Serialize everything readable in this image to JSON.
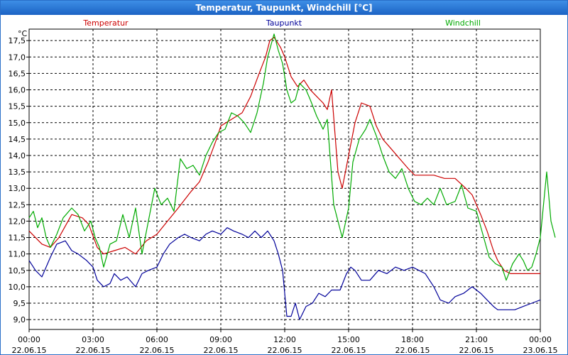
{
  "window": {
    "title": "Temperatur, Taupunkt, Windchill [°C]"
  },
  "chart_data": {
    "type": "line",
    "title": "Temperatur, Taupunkt, Windchill [°C]",
    "ylabel": "°C",
    "xlabel": "",
    "ylim": [
      8.7,
      17.85
    ],
    "xlim": [
      0,
      24
    ],
    "grid": true,
    "legend_position": "top",
    "y_ticks": [
      "9,0",
      "9,5",
      "10,0",
      "10,5",
      "11,0",
      "11,5",
      "12,0",
      "12,5",
      "13,0",
      "13,5",
      "14,0",
      "14,5",
      "15,0",
      "15,5",
      "16,0",
      "16,5",
      "17,0",
      "17,5"
    ],
    "y_tick_values": [
      9.0,
      9.5,
      10.0,
      10.5,
      11.0,
      11.5,
      12.0,
      12.5,
      13.0,
      13.5,
      14.0,
      14.5,
      15.0,
      15.5,
      16.0,
      16.5,
      17.0,
      17.5
    ],
    "x_ticks": [
      {
        "x": 0,
        "time": "00:00",
        "date": "22.06.15"
      },
      {
        "x": 3,
        "time": "03:00",
        "date": "22.06.15"
      },
      {
        "x": 6,
        "time": "06:00",
        "date": "22.06.15"
      },
      {
        "x": 9,
        "time": "09:00",
        "date": "22.06.15"
      },
      {
        "x": 12,
        "time": "12:00",
        "date": "22.06.15"
      },
      {
        "x": 15,
        "time": "15:00",
        "date": "22.06.15"
      },
      {
        "x": 18,
        "time": "18:00",
        "date": "22.06.15"
      },
      {
        "x": 21,
        "time": "21:00",
        "date": "22.06.15"
      },
      {
        "x": 24,
        "time": "00:00",
        "date": "23.06.15"
      }
    ],
    "series": [
      {
        "name": "Temperatur",
        "color": "#cc0000",
        "points": [
          [
            0,
            11.7
          ],
          [
            0.6,
            11.3
          ],
          [
            1.0,
            11.2
          ],
          [
            1.4,
            11.5
          ],
          [
            2.0,
            12.2
          ],
          [
            2.5,
            12.1
          ],
          [
            2.8,
            11.9
          ],
          [
            3.2,
            11.2
          ],
          [
            3.5,
            11.0
          ],
          [
            4.0,
            11.1
          ],
          [
            4.5,
            11.2
          ],
          [
            5.0,
            11.0
          ],
          [
            5.5,
            11.4
          ],
          [
            6.0,
            11.6
          ],
          [
            6.5,
            12.0
          ],
          [
            7.0,
            12.4
          ],
          [
            7.6,
            12.9
          ],
          [
            8.0,
            13.2
          ],
          [
            8.4,
            13.8
          ],
          [
            8.8,
            14.5
          ],
          [
            9.0,
            14.9
          ],
          [
            9.5,
            15.1
          ],
          [
            10.0,
            15.3
          ],
          [
            10.4,
            15.8
          ],
          [
            10.8,
            16.5
          ],
          [
            11.1,
            17.0
          ],
          [
            11.3,
            17.5
          ],
          [
            11.5,
            17.6
          ],
          [
            11.8,
            17.3
          ],
          [
            12.0,
            17.0
          ],
          [
            12.3,
            16.4
          ],
          [
            12.6,
            16.1
          ],
          [
            12.9,
            16.3
          ],
          [
            13.2,
            16.0
          ],
          [
            13.5,
            15.8
          ],
          [
            13.8,
            15.6
          ],
          [
            14.0,
            15.4
          ],
          [
            14.2,
            16.0
          ],
          [
            14.5,
            13.5
          ],
          [
            14.7,
            13.0
          ],
          [
            15.0,
            14.0
          ],
          [
            15.3,
            15.0
          ],
          [
            15.6,
            15.6
          ],
          [
            16.0,
            15.5
          ],
          [
            16.3,
            14.9
          ],
          [
            16.6,
            14.5
          ],
          [
            17.0,
            14.2
          ],
          [
            17.4,
            13.9
          ],
          [
            17.8,
            13.6
          ],
          [
            18.1,
            13.4
          ],
          [
            18.5,
            13.4
          ],
          [
            19.0,
            13.4
          ],
          [
            19.5,
            13.3
          ],
          [
            20.0,
            13.3
          ],
          [
            20.5,
            13.0
          ],
          [
            20.8,
            12.8
          ],
          [
            21.2,
            12.2
          ],
          [
            21.5,
            11.7
          ],
          [
            21.8,
            11.1
          ],
          [
            22.0,
            10.8
          ],
          [
            22.3,
            10.5
          ],
          [
            22.6,
            10.4
          ],
          [
            23.0,
            10.4
          ],
          [
            23.5,
            10.4
          ],
          [
            23.8,
            10.4
          ],
          [
            24.0,
            10.4
          ]
        ]
      },
      {
        "name": "Taupunkt",
        "color": "#000099",
        "points": [
          [
            0,
            10.8
          ],
          [
            0.3,
            10.5
          ],
          [
            0.6,
            10.3
          ],
          [
            1.0,
            10.9
          ],
          [
            1.3,
            11.3
          ],
          [
            1.7,
            11.4
          ],
          [
            2.0,
            11.1
          ],
          [
            2.3,
            11.0
          ],
          [
            2.7,
            10.8
          ],
          [
            3.0,
            10.6
          ],
          [
            3.2,
            10.2
          ],
          [
            3.5,
            10.0
          ],
          [
            3.8,
            10.1
          ],
          [
            4.0,
            10.4
          ],
          [
            4.3,
            10.2
          ],
          [
            4.6,
            10.3
          ],
          [
            5.0,
            10.0
          ],
          [
            5.3,
            10.4
          ],
          [
            5.6,
            10.5
          ],
          [
            6.0,
            10.6
          ],
          [
            6.3,
            11.0
          ],
          [
            6.6,
            11.3
          ],
          [
            7.0,
            11.5
          ],
          [
            7.3,
            11.6
          ],
          [
            7.6,
            11.5
          ],
          [
            8.0,
            11.4
          ],
          [
            8.3,
            11.6
          ],
          [
            8.6,
            11.7
          ],
          [
            9.0,
            11.6
          ],
          [
            9.3,
            11.8
          ],
          [
            9.6,
            11.7
          ],
          [
            10.0,
            11.6
          ],
          [
            10.3,
            11.5
          ],
          [
            10.6,
            11.7
          ],
          [
            10.9,
            11.5
          ],
          [
            11.2,
            11.7
          ],
          [
            11.5,
            11.4
          ],
          [
            11.7,
            11.0
          ],
          [
            11.9,
            10.5
          ],
          [
            12.1,
            9.1
          ],
          [
            12.3,
            9.1
          ],
          [
            12.5,
            9.5
          ],
          [
            12.7,
            9.0
          ],
          [
            13.0,
            9.4
          ],
          [
            13.3,
            9.5
          ],
          [
            13.6,
            9.8
          ],
          [
            13.9,
            9.7
          ],
          [
            14.2,
            9.9
          ],
          [
            14.6,
            9.9
          ],
          [
            14.9,
            10.4
          ],
          [
            15.1,
            10.6
          ],
          [
            15.3,
            10.5
          ],
          [
            15.6,
            10.2
          ],
          [
            16.0,
            10.2
          ],
          [
            16.4,
            10.5
          ],
          [
            16.8,
            10.4
          ],
          [
            17.2,
            10.6
          ],
          [
            17.6,
            10.5
          ],
          [
            18.0,
            10.6
          ],
          [
            18.3,
            10.5
          ],
          [
            18.6,
            10.4
          ],
          [
            19.0,
            10.0
          ],
          [
            19.3,
            9.6
          ],
          [
            19.7,
            9.5
          ],
          [
            20.0,
            9.7
          ],
          [
            20.4,
            9.8
          ],
          [
            20.8,
            10.0
          ],
          [
            21.2,
            9.8
          ],
          [
            21.5,
            9.6
          ],
          [
            21.8,
            9.4
          ],
          [
            22.0,
            9.3
          ],
          [
            22.4,
            9.3
          ],
          [
            22.8,
            9.3
          ],
          [
            23.2,
            9.4
          ],
          [
            23.6,
            9.5
          ],
          [
            24.0,
            9.6
          ]
        ]
      },
      {
        "name": "Windchill",
        "color": "#00aa00",
        "points": [
          [
            0,
            12.1
          ],
          [
            0.2,
            12.3
          ],
          [
            0.4,
            11.8
          ],
          [
            0.6,
            12.1
          ],
          [
            0.8,
            11.5
          ],
          [
            1.0,
            11.2
          ],
          [
            1.3,
            11.6
          ],
          [
            1.6,
            12.1
          ],
          [
            2.0,
            12.4
          ],
          [
            2.3,
            12.2
          ],
          [
            2.6,
            11.7
          ],
          [
            2.9,
            12.0
          ],
          [
            3.1,
            11.5
          ],
          [
            3.3,
            11.2
          ],
          [
            3.5,
            10.6
          ],
          [
            3.8,
            11.3
          ],
          [
            4.1,
            11.4
          ],
          [
            4.4,
            12.2
          ],
          [
            4.7,
            11.5
          ],
          [
            5.0,
            12.4
          ],
          [
            5.3,
            11.0
          ],
          [
            5.6,
            12.0
          ],
          [
            5.9,
            13.0
          ],
          [
            6.2,
            12.5
          ],
          [
            6.5,
            12.7
          ],
          [
            6.8,
            12.3
          ],
          [
            7.1,
            13.9
          ],
          [
            7.4,
            13.6
          ],
          [
            7.7,
            13.7
          ],
          [
            8.0,
            13.4
          ],
          [
            8.3,
            14.0
          ],
          [
            8.6,
            14.4
          ],
          [
            8.9,
            14.7
          ],
          [
            9.2,
            14.8
          ],
          [
            9.5,
            15.3
          ],
          [
            9.8,
            15.2
          ],
          [
            10.1,
            15.0
          ],
          [
            10.4,
            14.7
          ],
          [
            10.7,
            15.3
          ],
          [
            11.0,
            16.2
          ],
          [
            11.2,
            17.0
          ],
          [
            11.5,
            17.7
          ],
          [
            11.7,
            17.2
          ],
          [
            11.9,
            16.8
          ],
          [
            12.1,
            16.0
          ],
          [
            12.3,
            15.6
          ],
          [
            12.5,
            15.7
          ],
          [
            12.7,
            16.2
          ],
          [
            13.0,
            16.0
          ],
          [
            13.2,
            15.7
          ],
          [
            13.5,
            15.2
          ],
          [
            13.8,
            14.8
          ],
          [
            14.0,
            15.1
          ],
          [
            14.3,
            12.5
          ],
          [
            14.5,
            12.0
          ],
          [
            14.7,
            11.5
          ],
          [
            15.0,
            12.4
          ],
          [
            15.2,
            13.8
          ],
          [
            15.5,
            14.5
          ],
          [
            15.8,
            14.8
          ],
          [
            16.0,
            15.1
          ],
          [
            16.3,
            14.6
          ],
          [
            16.6,
            14.0
          ],
          [
            16.9,
            13.5
          ],
          [
            17.2,
            13.3
          ],
          [
            17.5,
            13.6
          ],
          [
            17.8,
            13.0
          ],
          [
            18.1,
            12.6
          ],
          [
            18.4,
            12.5
          ],
          [
            18.7,
            12.7
          ],
          [
            19.0,
            12.5
          ],
          [
            19.3,
            13.0
          ],
          [
            19.6,
            12.5
          ],
          [
            20.0,
            12.6
          ],
          [
            20.3,
            13.1
          ],
          [
            20.6,
            12.4
          ],
          [
            21.0,
            12.3
          ],
          [
            21.3,
            11.6
          ],
          [
            21.6,
            10.9
          ],
          [
            21.9,
            10.7
          ],
          [
            22.2,
            10.6
          ],
          [
            22.4,
            10.2
          ],
          [
            22.7,
            10.7
          ],
          [
            23.0,
            11.0
          ],
          [
            23.2,
            10.8
          ],
          [
            23.4,
            10.5
          ],
          [
            23.6,
            10.6
          ],
          [
            23.8,
            11.0
          ],
          [
            24.0,
            11.5
          ],
          [
            24.3,
            13.5
          ],
          [
            24.5,
            12.0
          ],
          [
            24.7,
            11.5
          ]
        ]
      }
    ]
  }
}
